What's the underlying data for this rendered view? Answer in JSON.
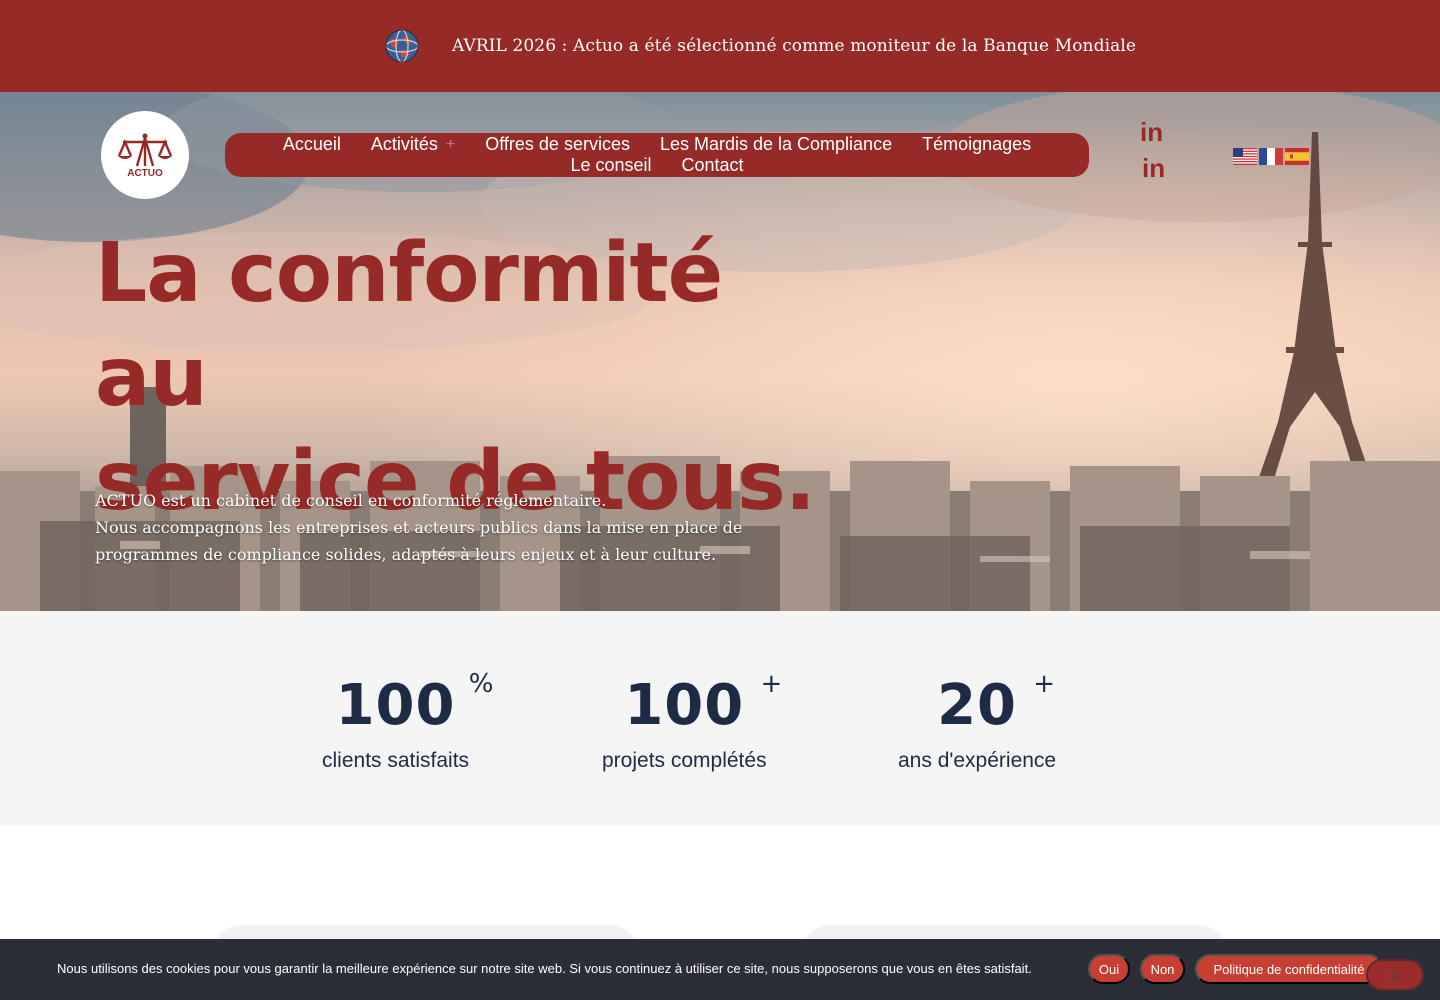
{
  "announcement": {
    "text": "AVRIL 2026 : Actuo  a été sélectionné comme moniteur de la Banque Mondiale",
    "icon": "globe-icon"
  },
  "logo": {
    "text": "ACTUO",
    "icon": "scales-icon"
  },
  "nav": {
    "items": [
      {
        "label": "Accueil"
      },
      {
        "label": "Activités",
        "has_submenu": true
      },
      {
        "label": "Offres de services"
      },
      {
        "label": "Les Mardis de la Compliance"
      },
      {
        "label": "Témoignages"
      },
      {
        "label": "Le conseil"
      },
      {
        "label": "Contact"
      }
    ]
  },
  "social": {
    "linkedin_label": "in"
  },
  "flags": [
    "us-flag-icon",
    "fr-flag-icon",
    "es-flag-icon"
  ],
  "hero": {
    "title_line1": "La conformité au",
    "title_line2": "service de tous.",
    "desc_line1": "ACTUO est un cabinet de conseil en conformité réglementaire.",
    "desc_line2": "Nous accompagnons les entreprises et acteurs publics dans la mise en place de",
    "desc_line3": "programmes de compliance solides, adaptés à leurs enjeux et à leur culture."
  },
  "stats": [
    {
      "value": "100",
      "suffix": "%",
      "label": "clients satisfaits"
    },
    {
      "value": "100",
      "suffix": "+",
      "label": "projets complétés"
    },
    {
      "value": "20",
      "suffix": "+",
      "label": "ans d'expérience"
    }
  ],
  "cookie": {
    "text": "Nous utilisons des cookies pour vous garantir la meilleure expérience sur notre site web. Si vous continuez à utiliser ce site, nous supposerons que vous en êtes satisfait.",
    "yes": "Oui",
    "no": "Non",
    "privacy": "Politique de confidentialité"
  },
  "colors": {
    "brand_red": "#962a27",
    "navy": "#1d2b45",
    "cookie_bg": "#2b2e37",
    "cookie_button": "#c73f33"
  }
}
